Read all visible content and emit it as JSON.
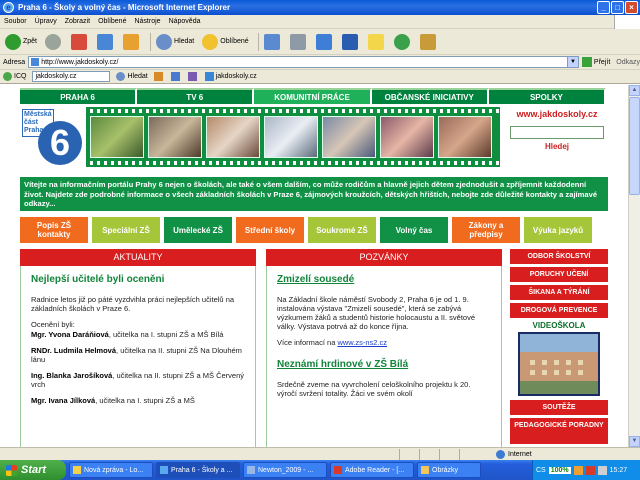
{
  "window": {
    "title": "Praha 6 - Školy a volný čas - Microsoft Internet Explorer"
  },
  "menu": [
    "Soubor",
    "Úpravy",
    "Zobrazit",
    "Oblíbené",
    "Nástroje",
    "Nápověda"
  ],
  "toolbar": {
    "back": "Zpět",
    "search": "Hledat",
    "favorites": "Oblíbené"
  },
  "address": {
    "label": "Adresa",
    "url": "http://www.jakdoskoly.cz/",
    "go": "Přejít",
    "links": "Odkazy"
  },
  "linksbar": {
    "icq": "ICQ",
    "field": "jakdoskoly.cz",
    "search": "Hledat",
    "site": "jakdoskoly.cz"
  },
  "page": {
    "nav": [
      "PRAHA 6",
      "TV 6",
      "KOMUNITNÍ PRÁCE",
      "OBČANSKÉ INICIATIVY",
      "SPOLKY"
    ],
    "logo": {
      "line1": "Městská",
      "line2": "část",
      "line3": "Praha",
      "number": "6"
    },
    "site_url": "www.jakdoskoly.cz",
    "search_button": "Hledej",
    "intro": "Vítejte na informačním portálu Prahy 6 nejen o školách, ale také o všem dalším, co může rodičům a hlavně jejich dětem zjednodušit a zpříjemnit každodenní život. Najdete zde podrobné informace o všech základních školách v Praze 6, zájmových kroužcích, dětských hřištích, nebojte zde důležité kontakty a zajímavé odkazy...",
    "categories": [
      {
        "label": "Popis ZŠ kontakty",
        "color": "#f06b1e"
      },
      {
        "label": "Speciální ZŠ",
        "color": "#a6c63a"
      },
      {
        "label": "Umělecké ZŠ",
        "color": "#119146"
      },
      {
        "label": "Střední školy",
        "color": "#f06b1e"
      },
      {
        "label": "Soukromé ZŠ",
        "color": "#a6c63a"
      },
      {
        "label": "Volný čas",
        "color": "#119146"
      },
      {
        "label": "Zákony a předpisy",
        "color": "#f06b1e"
      },
      {
        "label": "Výuka jazyků",
        "color": "#a6c63a"
      }
    ],
    "aktuality": {
      "heading": "AKTUALITY",
      "title": "Nejlepší učitelé byli oceněni",
      "p1": "Radnice letos již po páté vyzdvihla práci nejlepších učitelů na základních školách v Praze 6.",
      "p2": "Ocenění byli:",
      "people": [
        {
          "name": "Mgr. Yvona Daráňiová",
          "desc": ", učitelka na I. stupni ZŠ a MŠ Bílá"
        },
        {
          "name": "RNDr. Ludmila Helmová",
          "desc": ", učitelka na II. stupni ZŠ Na Dlouhém lánu"
        },
        {
          "name": "Ing. Blanka Jarošíková",
          "desc": ", učitelka na II. stupni ZŠ a MŠ Červený vrch"
        },
        {
          "name": "Mgr. Ivana Jílková",
          "desc": ", učitelka na I. stupni ZŠ a MŠ"
        }
      ]
    },
    "pozvanky": {
      "heading": "POZVÁNKY",
      "title1": "Zmizelí sousedé",
      "p1": "Na Základní škole náměstí Svobody 2, Praha 6 je od 1. 9. instalována výstava \"Zmizelí sousedé\", která se zabývá výzkumem žáků a studentů historie holocaustu a II. světové války. Výstava potrvá až do konce října.",
      "more_prefix": "Více informací na ",
      "more_link": "www.zs-ns2.cz",
      "title2": "Neznámí hrdinové v ZŠ Bílá",
      "p2": "Srdečně zveme na vyvrcholení celoškolního projektu k 20. výročí svržení totality. Žáci ve svém okolí"
    },
    "sidebar": {
      "buttons": [
        "ODBOR ŠKOLSTVÍ",
        "PORUCHY UČENÍ",
        "ŠIKANA A TÝRÁNÍ",
        "DROGOVÁ PREVENCE"
      ],
      "video_heading": "VIDEOŠKOLA",
      "buttons2": [
        "SOUTĚŽE",
        "PEDAGOGICKÉ PORADNY"
      ]
    }
  },
  "status": {
    "zone": "Internet"
  },
  "taskbar": {
    "start": "Start",
    "tasks": [
      "Nová zpráva - Lo...",
      "Praha 6 - Školy a ...",
      "Newton_2009 - ...",
      "Adobe Reader - [...",
      "Obrázky"
    ],
    "lang": "CS",
    "battery": "100%",
    "clock": "15:27"
  },
  "colors": {
    "green": "#119146",
    "red": "#d81e1e",
    "orange": "#f06b1e",
    "lime": "#a6c63a"
  }
}
